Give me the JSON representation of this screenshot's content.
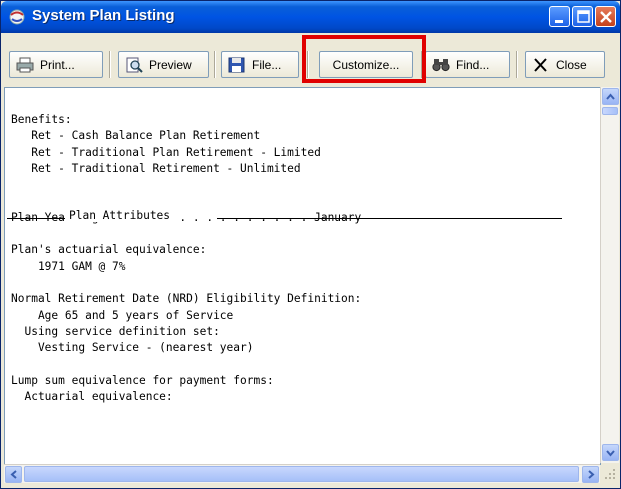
{
  "window": {
    "title": "System Plan Listing"
  },
  "toolbar": {
    "print_label": "Print...",
    "preview_label": "Preview",
    "file_label": "File...",
    "customize_label": "Customize...",
    "find_label": "Find...",
    "close_label": "Close"
  },
  "listing": {
    "text": "Benefits:\n   Ret - Cash Balance Plan Retirement\n   Ret - Traditional Plan Retirement - Limited\n   Ret - Traditional Retirement - Unlimited\n\n\nPlan Year begins . . . . . . . . . . . . . . January\n\nPlan's actuarial equivalence:\n    1971 GAM @ 7%\n\nNormal Retirement Date (NRD) Eligibility Definition:\n    Age 65 and 5 years of Service\n  Using service definition set:\n    Vesting Service - (nearest year)\n\nLump sum equivalence for payment forms:\n  Actuarial equivalence:",
    "section_title": "Plan Attributes"
  },
  "colors": {
    "highlight": "#e00000",
    "titlebar": "#0054e3"
  },
  "icons": [
    "app-icon",
    "printer-icon",
    "preview-icon",
    "floppy-disk-icon",
    "binoculars-icon",
    "close-x-icon"
  ]
}
